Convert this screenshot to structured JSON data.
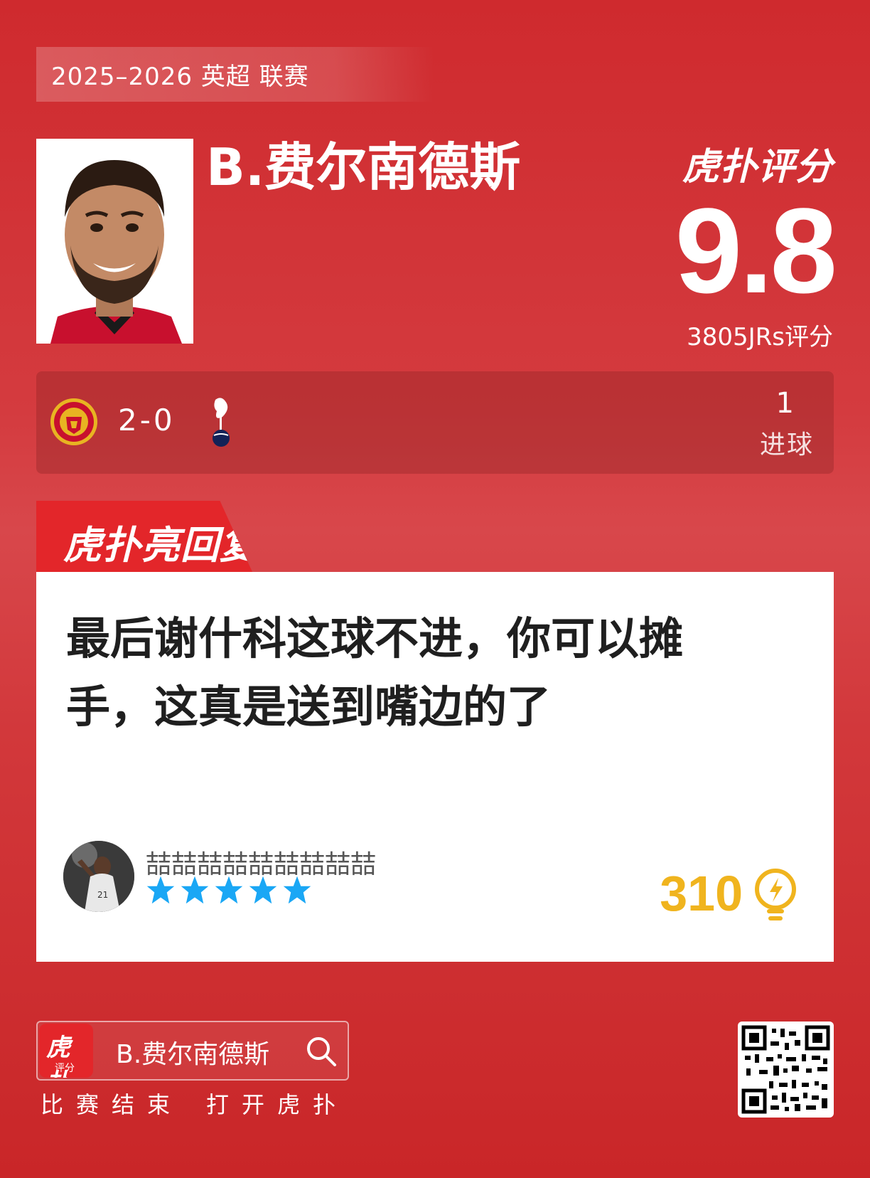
{
  "header": {
    "season_league": "2025–2026 英超 联赛"
  },
  "player": {
    "name": "B.费尔南德斯"
  },
  "brand": {
    "title": "虎扑评分",
    "jr_mark": "JR"
  },
  "rating": {
    "value": "9.8",
    "count_label": "3805JRs评分"
  },
  "match": {
    "score": "2-0",
    "home_logo": "manchester-united-crest",
    "away_logo": "tottenham-cockerel-crest",
    "stat_value": "1",
    "stat_label": "进球"
  },
  "comment": {
    "section_label": "虎扑亮回复",
    "text": "最后谢什科这球不进，你可以摊手，这真是送到嘴边的了",
    "user_name": "喆喆喆喆喆喆喆喆喆",
    "stars": 5,
    "likes": "310",
    "like_icon": "lightbulb-icon"
  },
  "footer": {
    "app_icon_text": "虎扑",
    "app_icon_subtext": "评分",
    "search_text": "B.费尔南德斯",
    "left_label": "比赛结束",
    "right_label": "打开虎扑"
  },
  "colors": {
    "background": "#cf2a2e",
    "accent": "#e3262a",
    "like": "#f0b41e",
    "star": "#1aa7f5"
  }
}
